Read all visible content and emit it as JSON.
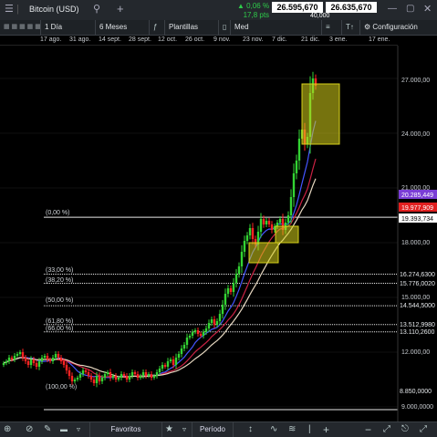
{
  "header": {
    "symbol": "Bitcoin (USD)",
    "change_pct": "0,06 %",
    "change_pts": "17,8 pts",
    "sell": "26.595,670",
    "buy": "26.635,670",
    "spread": "40,000"
  },
  "toolbar": {
    "timeframe": "1 Día",
    "range": "6 Meses",
    "templates": "Plantillas",
    "price_type": "Med",
    "settings": "Configuración"
  },
  "dates": [
    "17 ago.",
    "31 ago.",
    "14 sept.",
    "28 sept.",
    "12 oct.",
    "26 oct.",
    "9 nov.",
    "23 nov.",
    "7 dic.",
    "21 dic.",
    "3 ene.",
    "17 ene."
  ],
  "price_axis": {
    "ticks": [
      "27.000,00",
      "24.000,00",
      "21.000,00",
      "18.000,00",
      "15.000,00",
      "12.000,00",
      "9.000,0000"
    ],
    "badges": [
      {
        "text": "20.285,449",
        "color": "#7a3dd6"
      },
      {
        "text": "19.977,909",
        "color": "#e02020"
      },
      {
        "text": "19.393,734",
        "color": "#ffffff"
      }
    ],
    "fib_values": [
      "16.274,6300",
      "15.776,0020",
      "14.544,5000",
      "13.512,9980",
      "13.110,2600",
      "8.850,0000"
    ]
  },
  "fib_levels": [
    "(0,00 %)",
    "(33,00 %)",
    "(38,20 %)",
    "(50,00 %)",
    "(61,80 %)",
    "(66,00 %)",
    "(100,00 %)"
  ],
  "bottom": {
    "favorites": "Favoritos",
    "period": "Período"
  },
  "chart_data": {
    "type": "candlestick",
    "colors": {
      "up": "#33d433",
      "down": "#ff2222",
      "ma_fast": "#4455ff",
      "ma_mid": "#cc2244",
      "ma_slow": "#e6d7c0",
      "box": "#d7d21a"
    },
    "ylim": [
      9000,
      28000
    ],
    "fib_prices": [
      19393.734,
      16274.63,
      15776.002,
      14544.5,
      13512.998,
      13110.26,
      8850.0
    ],
    "closes": [
      11400,
      11500,
      11700,
      11600,
      11800,
      11900,
      12000,
      11700,
      11500,
      11300,
      11600,
      11400,
      11200,
      11500,
      11700,
      11800,
      11600,
      11500,
      11700,
      11900,
      11700,
      11500,
      11300,
      11000,
      10700,
      10400,
      10500,
      10600,
      10800,
      11000,
      10900,
      10700,
      10500,
      10300,
      10700,
      10400,
      10600,
      10800,
      10900,
      10600,
      10700,
      10500,
      10600,
      10800,
      10700,
      10500,
      10700,
      10900,
      10800,
      10600,
      10700,
      10900,
      10700,
      10800,
      10600,
      10700,
      10900,
      11100,
      11300,
      11200,
      11500,
      11600,
      11300,
      11700,
      11900,
      12200,
      12400,
      12800,
      12900,
      13100,
      13200,
      13000,
      12900,
      13100,
      13300,
      13600,
      13800,
      13500,
      13700,
      14100,
      14600,
      15200,
      15500,
      15300,
      15800,
      16300,
      16700,
      17500,
      18100,
      18400,
      18800,
      18200,
      17900,
      18600,
      19300,
      19000,
      19200,
      19000,
      18700,
      18900,
      19100,
      19300,
      18700,
      19100,
      19500,
      20500,
      21800,
      22500,
      23700,
      24200,
      23400,
      23800,
      26200,
      27000,
      26600
    ]
  }
}
